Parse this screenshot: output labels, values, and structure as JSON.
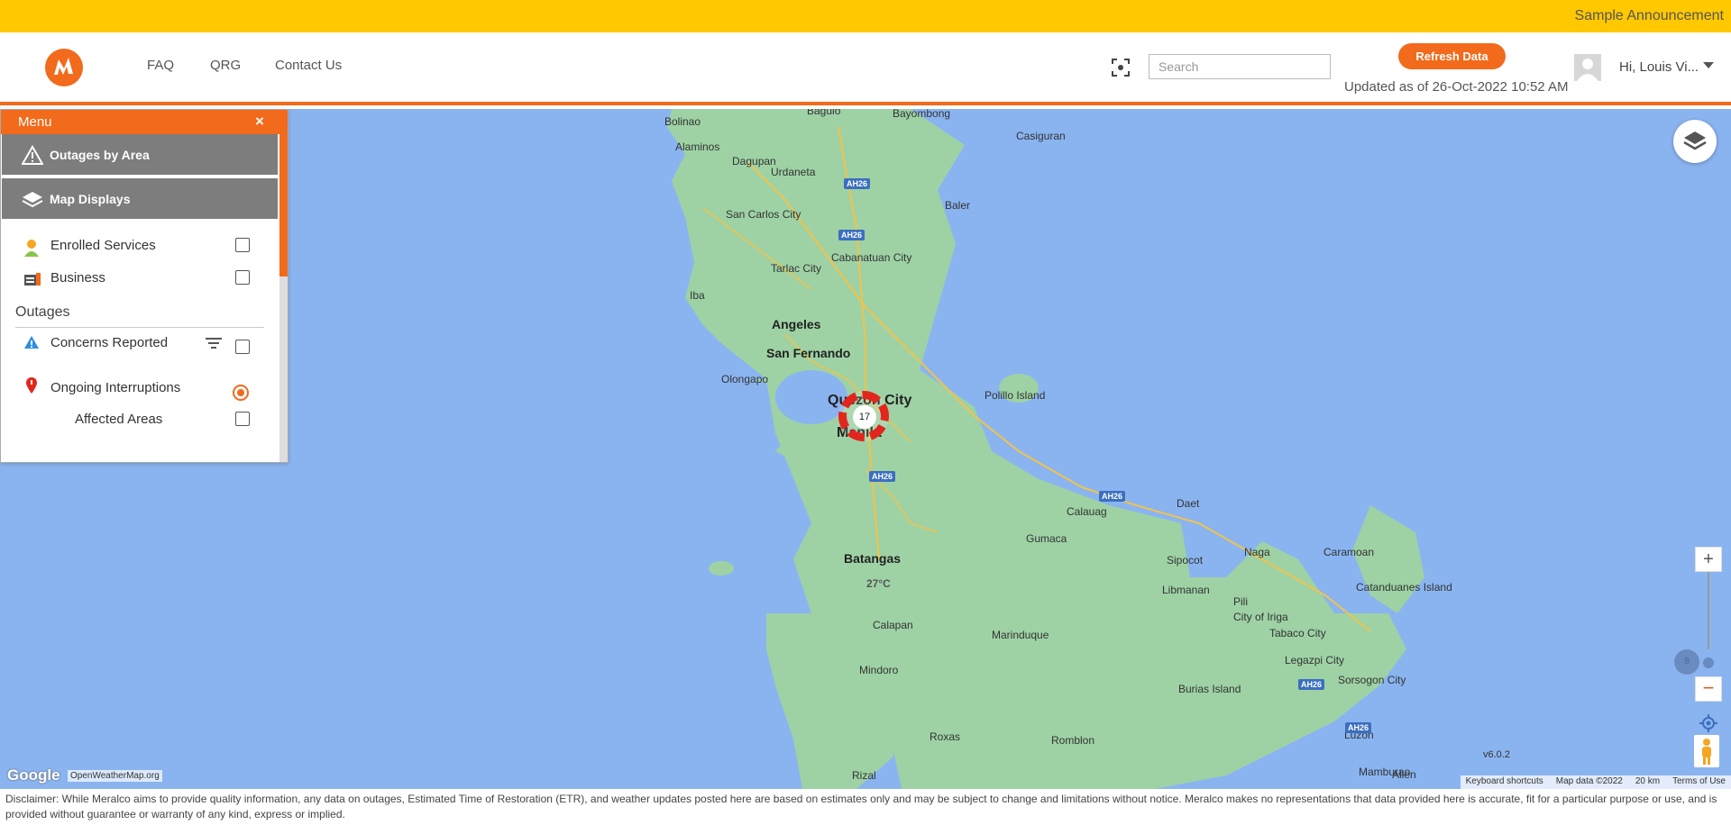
{
  "announcement": "Sample Announcement",
  "nav": {
    "faq": "FAQ",
    "qrg": "QRG",
    "contact": "Contact Us"
  },
  "search": {
    "placeholder": "Search"
  },
  "refresh_label": "Refresh Data",
  "updated_text": "Updated as of 26-Oct-2022 10:52 AM",
  "user_greeting": "Hi, Louis Vi...",
  "menu": {
    "title": "Menu",
    "close": "×",
    "sections": [
      "Outages by Area",
      "Map Displays"
    ],
    "map_displays": [
      {
        "label": "Enrolled Services",
        "checked": false
      },
      {
        "label": "Business",
        "checked": false
      }
    ],
    "outages_heading": "Outages",
    "outages": [
      {
        "label": "Concerns Reported",
        "checked": false
      },
      {
        "label": "Ongoing Interruptions",
        "selected": true
      },
      {
        "label": "Affected Areas",
        "checked": false
      }
    ]
  },
  "map": {
    "cluster_count": "17",
    "temperature": "27°C",
    "version": "v6.0.2",
    "places": [
      "Baguio",
      "Bayombong",
      "Bolinao",
      "Alaminos",
      "Casiguran",
      "Dagupan",
      "Urdaneta",
      "San Carlos City",
      "Baler",
      "Tarlac City",
      "Cabanatuan City",
      "Iba",
      "Angeles",
      "San Fernando",
      "Olongapo",
      "Quezon City",
      "Polillo Island",
      "Manila",
      "Calauag",
      "Daet",
      "Gumaca",
      "Caramoan",
      "Batangas",
      "Sipocot",
      "Naga",
      "Catanduanes Island",
      "Libmanan",
      "Pili",
      "City of Iriga",
      "Tabaco City",
      "Calapan",
      "Marinduque",
      "Legazpi City",
      "Sorsogon City",
      "Mindoro",
      "Burias Island",
      "Luzon",
      "Roxas",
      "Romblon",
      "Rizal",
      "Mamburao",
      "Allen"
    ],
    "highways": [
      "AH26",
      "AH26",
      "AH26",
      "AH26",
      "AH26",
      "AH26"
    ],
    "google": "Google",
    "owm": "OpenWeatherMap.org",
    "footer": [
      "Keyboard shortcuts",
      "Map data ©2022",
      "20 km",
      "Terms of Use"
    ]
  },
  "disclaimer": "Disclaimer: While Meralco aims to provide quality information, any data on outages, Estimated Time of Restoration (ETR), and weather updates posted here are based on estimates only and may be subject to change and limitations without notice. Meralco makes no representations that data provided here is accurate, fit for a particular purpose or use, and is provided without guarantee or warranty of any kind, express or implied."
}
